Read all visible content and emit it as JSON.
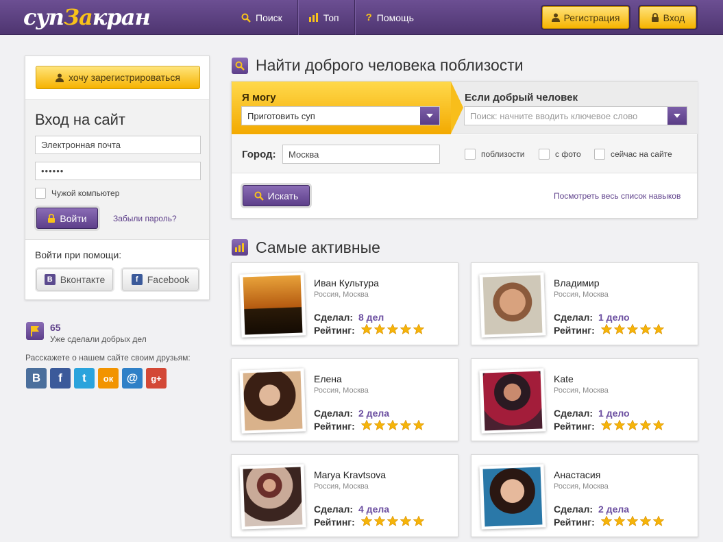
{
  "header": {
    "logo": {
      "part1": "суп",
      "part2": "За",
      "part3": "кран"
    },
    "nav": [
      {
        "label": "Поиск"
      },
      {
        "label": "Топ"
      },
      {
        "label": "Помощь"
      }
    ],
    "register_label": "Регистрация",
    "login_label": "Вход"
  },
  "sidebar": {
    "want_register_label": "хочу зарегистрироваться",
    "login_title": "Вход на сайт",
    "email_value": "Электронная почта",
    "password_value": "••••••",
    "foreign_computer_label": "Чужой компьютер",
    "enter_label": "Войти",
    "forgot_label": "Забыли пароль?",
    "via_title": "Войти при помощи:",
    "vk_label": "Вконтакте",
    "fb_label": "Facebook",
    "stats_count": "65",
    "stats_label": "Уже сделали добрых дел",
    "share_title": "Расскажете о нашем сайте своим друзьям:",
    "share_icons": [
      {
        "name": "vkontakte-icon",
        "glyph": "B",
        "color": "#4b6f9c"
      },
      {
        "name": "facebook-icon",
        "glyph": "f",
        "color": "#3b5a9a"
      },
      {
        "name": "twitter-icon",
        "glyph": "t",
        "color": "#2aa3dc"
      },
      {
        "name": "odnoklassniki-icon",
        "glyph": "ок",
        "color": "#f29400"
      },
      {
        "name": "mailru-icon",
        "glyph": "@",
        "color": "#2f80c7"
      },
      {
        "name": "googleplus-icon",
        "glyph": "g+",
        "color": "#d34836"
      }
    ]
  },
  "search": {
    "title": "Найти доброго человека поблизости",
    "can_label": "Я могу",
    "can_value": "Приготовить суп",
    "need_label": "Если добрый человек",
    "need_placeholder": "Поиск: начните вводить ключевое слово",
    "city_label": "Город:",
    "city_value": "Москва",
    "filters": [
      "поблизости",
      "с фото",
      "сейчас на сайте"
    ],
    "search_label": "Искать",
    "all_skills_label": "Посмотреть весь список навыков"
  },
  "active": {
    "title": "Самые активные",
    "done_label": "Сделал:",
    "rating_label": "Рейтинг:",
    "users": [
      {
        "name": "Иван Культура",
        "location": "Россия, Москва",
        "done": "8 дел",
        "rating": 5
      },
      {
        "name": "Владимир",
        "location": "Россия, Москва",
        "done": "1 дело",
        "rating": 5
      },
      {
        "name": "Елена",
        "location": "Россия, Москва",
        "done": "2 дела",
        "rating": 5
      },
      {
        "name": "Kate",
        "location": "Россия, Москва",
        "done": "1 дело",
        "rating": 5
      },
      {
        "name": "Marya Kravtsova",
        "location": "Россия, Москва",
        "done": "4 дела",
        "rating": 5
      },
      {
        "name": "Анастасия",
        "location": "Россия, Москва",
        "done": "2 дела",
        "rating": 5
      }
    ]
  },
  "colors": {
    "header_purple": "#5d3f8a",
    "accent_yellow": "#f6b400",
    "link_purple": "#5d3f8a",
    "star_yellow": "#f5b40a"
  }
}
